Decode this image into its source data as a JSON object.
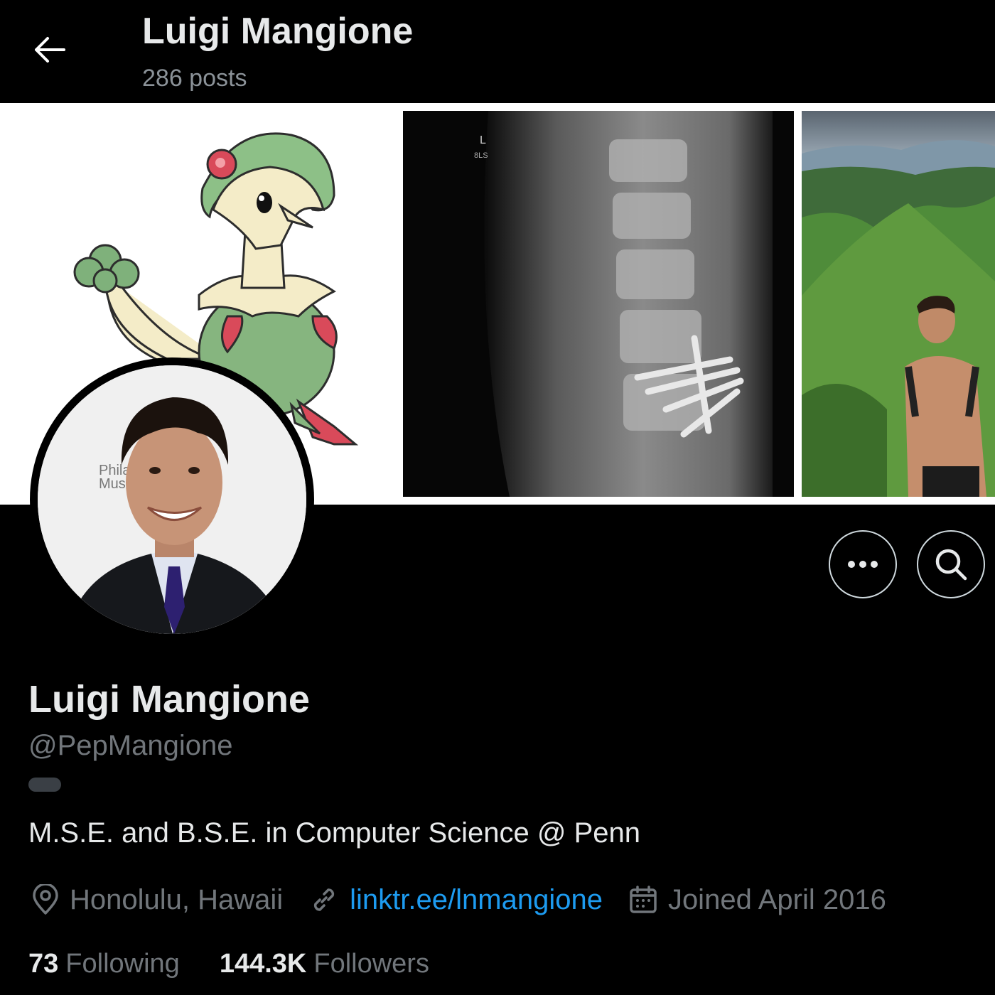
{
  "header": {
    "title": "Luigi Mangione",
    "posts": "286 posts"
  },
  "banner": {
    "museum_text_line1": "Philad",
    "museum_text_line2": "Muse",
    "xray_marker": "L",
    "xray_code": "8LS"
  },
  "profile": {
    "display_name": "Luigi Mangione",
    "handle": "@PepMangione",
    "bio": "M.S.E. and B.S.E. in Computer Science @ Penn",
    "location": "Honolulu, Hawaii",
    "link": "linktr.ee/lnmangione",
    "joined": "Joined April 2016"
  },
  "stats": {
    "following_count": "73",
    "following_label": "Following",
    "followers_count": "144.3K",
    "followers_label": "Followers"
  },
  "colors": {
    "background": "#000000",
    "text": "#e7e9ea",
    "muted": "#71767b",
    "link": "#1d9bf0"
  },
  "icons": [
    "back-arrow-icon",
    "more-icon",
    "search-icon",
    "location-pin-icon",
    "link-icon",
    "calendar-icon"
  ]
}
